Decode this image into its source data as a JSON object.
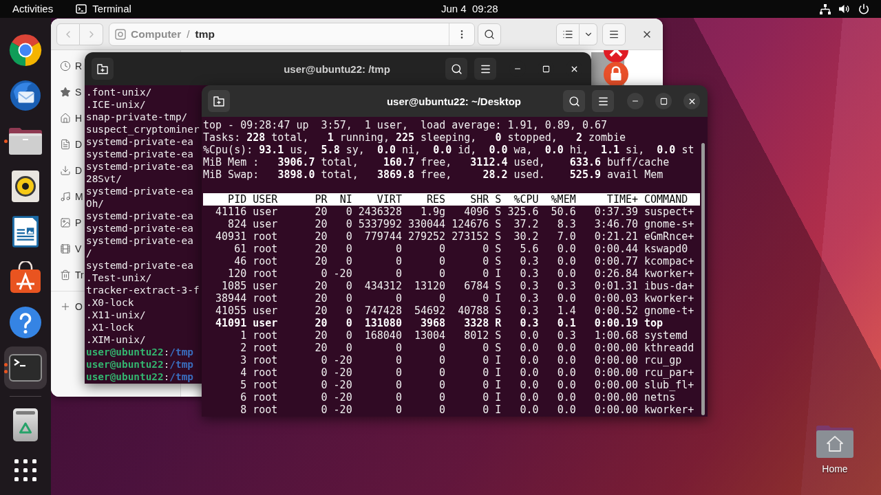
{
  "top_bar": {
    "activities": "Activities",
    "app_menu": "Terminal",
    "clock": "Jun 4  09:28"
  },
  "dock": {
    "items": [
      {
        "kind": "browser",
        "selected": false,
        "running": false,
        "multiple_windows": false
      },
      {
        "kind": "mail",
        "selected": false,
        "running": false,
        "multiple_windows": false
      },
      {
        "kind": "files",
        "selected": false,
        "running": true,
        "multiple_windows": false
      },
      {
        "kind": "music",
        "selected": false,
        "running": false,
        "multiple_windows": false
      },
      {
        "kind": "writer",
        "selected": false,
        "running": false,
        "multiple_windows": false
      },
      {
        "kind": "store",
        "selected": false,
        "running": false,
        "multiple_windows": false
      },
      {
        "kind": "help",
        "selected": false,
        "running": false,
        "multiple_windows": false
      },
      {
        "kind": "terminal",
        "selected": true,
        "running": true,
        "multiple_windows": true
      }
    ],
    "extras": [
      {
        "kind": "trash"
      },
      {
        "kind": "apps"
      }
    ]
  },
  "file_manager": {
    "back": {
      "disabled": true
    },
    "forward": {
      "disabled": true
    },
    "path": [
      {
        "label": "Computer",
        "current": false
      },
      {
        "label": "tmp",
        "current": true
      }
    ],
    "path_separator": "/",
    "sidebar": [
      {
        "kind": "recent",
        "label": "R"
      },
      {
        "kind": "starred",
        "label": "S"
      },
      {
        "kind": "home",
        "label": "H"
      },
      {
        "kind": "documents",
        "label": "D"
      },
      {
        "kind": "downloads",
        "label": "D"
      },
      {
        "kind": "music",
        "label": "M"
      },
      {
        "kind": "pictures",
        "label": "P"
      },
      {
        "kind": "videos",
        "label": "V"
      },
      {
        "kind": "trash",
        "label": "Tr"
      }
    ],
    "other_locations": {
      "label": "O"
    }
  },
  "terminal_back": {
    "title": "user@ubuntu22: /tmp",
    "focused": false,
    "lines": [
      {
        "kind": "text",
        "text": ".font-unix/"
      },
      {
        "kind": "text",
        "text": ".ICE-unix/"
      },
      {
        "kind": "text",
        "text": "snap-private-tmp/"
      },
      {
        "kind": "text",
        "text": "suspect_cryptominer"
      },
      {
        "kind": "text",
        "text": "systemd-private-ea"
      },
      {
        "kind": "text",
        "text": "systemd-private-ea"
      },
      {
        "kind": "text",
        "text": "systemd-private-ea"
      },
      {
        "kind": "text",
        "text": "28Svt/"
      },
      {
        "kind": "text",
        "text": "systemd-private-ea"
      },
      {
        "kind": "text",
        "text": "Oh/"
      },
      {
        "kind": "text",
        "text": "systemd-private-ea"
      },
      {
        "kind": "text",
        "text": "systemd-private-ea"
      },
      {
        "kind": "text",
        "text": "systemd-private-ea"
      },
      {
        "kind": "text",
        "text": "/"
      },
      {
        "kind": "text",
        "text": "systemd-private-ea"
      },
      {
        "kind": "text",
        "text": ".Test-unix/"
      },
      {
        "kind": "text",
        "text": "tracker-extract-3-f"
      },
      {
        "kind": "text",
        "text": ".X0-lock"
      },
      {
        "kind": "text",
        "text": ".X11-unix/"
      },
      {
        "kind": "text",
        "text": ".X1-lock"
      },
      {
        "kind": "text",
        "text": ".XIM-unix/"
      },
      {
        "kind": "prompt",
        "user_host": "user@ubuntu22",
        "separator": ":",
        "path": "/tmp"
      },
      {
        "kind": "prompt",
        "user_host": "user@ubuntu22",
        "separator": ":",
        "path": "/tmp"
      },
      {
        "kind": "prompt",
        "user_host": "user@ubuntu22",
        "separator": ":",
        "path": "/tmp"
      }
    ]
  },
  "terminal_front": {
    "title": "user@ubuntu22: ~/Desktop",
    "focused": true,
    "summary": [
      "top - 09:28:47 up  3:57,  1 user,  load average: 1.91, 0.89, 0.67",
      "Tasks: **228** total,   **1** running, **225** sleeping,   **0** stopped,   **2** zombie",
      "%Cpu(s): **93.1** us,  **5.8** sy,  **0.0** ni,  **0.0** id,  **0.0** wa,  **0.0** hi,  **1.1** si,  **0.0** st",
      "MiB Mem :   **3906.7** total,    **160.7** free,   **3112.4** used,    **633.6** buff/cache",
      "MiB Swap:   **3898.0** total,   **3869.8** free,     **28.2** used.    **525.9** avail Mem"
    ],
    "table": {
      "columns": [
        "PID",
        "USER",
        "PR",
        "NI",
        "VIRT",
        "RES",
        "SHR",
        "S",
        "%CPU",
        "%MEM",
        "TIME+",
        "COMMAND"
      ],
      "rows": [
        {
          "highlighted": false,
          "cells": [
            "41116",
            "user",
            "20",
            "0",
            "2436328",
            "1.9g",
            "4096",
            "S",
            "325.6",
            "50.6",
            "0:37.39",
            "suspect+"
          ]
        },
        {
          "highlighted": false,
          "cells": [
            "824",
            "user",
            "20",
            "0",
            "5337992",
            "330044",
            "124676",
            "S",
            "37.2",
            "8.3",
            "3:46.70",
            "gnome-s+"
          ]
        },
        {
          "highlighted": false,
          "cells": [
            "40931",
            "root",
            "20",
            "0",
            "779744",
            "279252",
            "273152",
            "S",
            "30.2",
            "7.0",
            "0:21.21",
            "eGmRnce+"
          ]
        },
        {
          "highlighted": false,
          "cells": [
            "61",
            "root",
            "20",
            "0",
            "0",
            "0",
            "0",
            "S",
            "5.6",
            "0.0",
            "0:00.44",
            "kswapd0"
          ]
        },
        {
          "highlighted": false,
          "cells": [
            "46",
            "root",
            "20",
            "0",
            "0",
            "0",
            "0",
            "S",
            "0.3",
            "0.0",
            "0:00.77",
            "kcompac+"
          ]
        },
        {
          "highlighted": false,
          "cells": [
            "120",
            "root",
            "0",
            "-20",
            "0",
            "0",
            "0",
            "I",
            "0.3",
            "0.0",
            "0:26.84",
            "kworker+"
          ]
        },
        {
          "highlighted": false,
          "cells": [
            "1085",
            "user",
            "20",
            "0",
            "434312",
            "13120",
            "6784",
            "S",
            "0.3",
            "0.3",
            "0:01.31",
            "ibus-da+"
          ]
        },
        {
          "highlighted": false,
          "cells": [
            "38944",
            "root",
            "20",
            "0",
            "0",
            "0",
            "0",
            "I",
            "0.3",
            "0.0",
            "0:00.03",
            "kworker+"
          ]
        },
        {
          "highlighted": false,
          "cells": [
            "41055",
            "user",
            "20",
            "0",
            "747428",
            "54692",
            "40788",
            "S",
            "0.3",
            "1.4",
            "0:00.52",
            "gnome-t+"
          ]
        },
        {
          "highlighted": true,
          "cells": [
            "41091",
            "user",
            "20",
            "0",
            "131080",
            "3968",
            "3328",
            "R",
            "0.3",
            "0.1",
            "0:00.19",
            "top"
          ]
        },
        {
          "highlighted": false,
          "cells": [
            "1",
            "root",
            "20",
            "0",
            "168040",
            "13004",
            "8012",
            "S",
            "0.0",
            "0.3",
            "1:00.68",
            "systemd"
          ]
        },
        {
          "highlighted": false,
          "cells": [
            "2",
            "root",
            "20",
            "0",
            "0",
            "0",
            "0",
            "S",
            "0.0",
            "0.0",
            "0:00.00",
            "kthreadd"
          ]
        },
        {
          "highlighted": false,
          "cells": [
            "3",
            "root",
            "0",
            "-20",
            "0",
            "0",
            "0",
            "I",
            "0.0",
            "0.0",
            "0:00.00",
            "rcu_gp"
          ]
        },
        {
          "highlighted": false,
          "cells": [
            "4",
            "root",
            "0",
            "-20",
            "0",
            "0",
            "0",
            "I",
            "0.0",
            "0.0",
            "0:00.00",
            "rcu_par+"
          ]
        },
        {
          "highlighted": false,
          "cells": [
            "5",
            "root",
            "0",
            "-20",
            "0",
            "0",
            "0",
            "I",
            "0.0",
            "0.0",
            "0:00.00",
            "slub_fl+"
          ]
        },
        {
          "highlighted": false,
          "cells": [
            "6",
            "root",
            "0",
            "-20",
            "0",
            "0",
            "0",
            "I",
            "0.0",
            "0.0",
            "0:00.00",
            "netns"
          ]
        },
        {
          "highlighted": false,
          "cells": [
            "8",
            "root",
            "0",
            "-20",
            "0",
            "0",
            "0",
            "I",
            "0.0",
            "0.0",
            "0:00.00",
            "kworker+"
          ]
        }
      ]
    }
  },
  "desktop_icons": [
    {
      "label": "Home"
    }
  ]
}
